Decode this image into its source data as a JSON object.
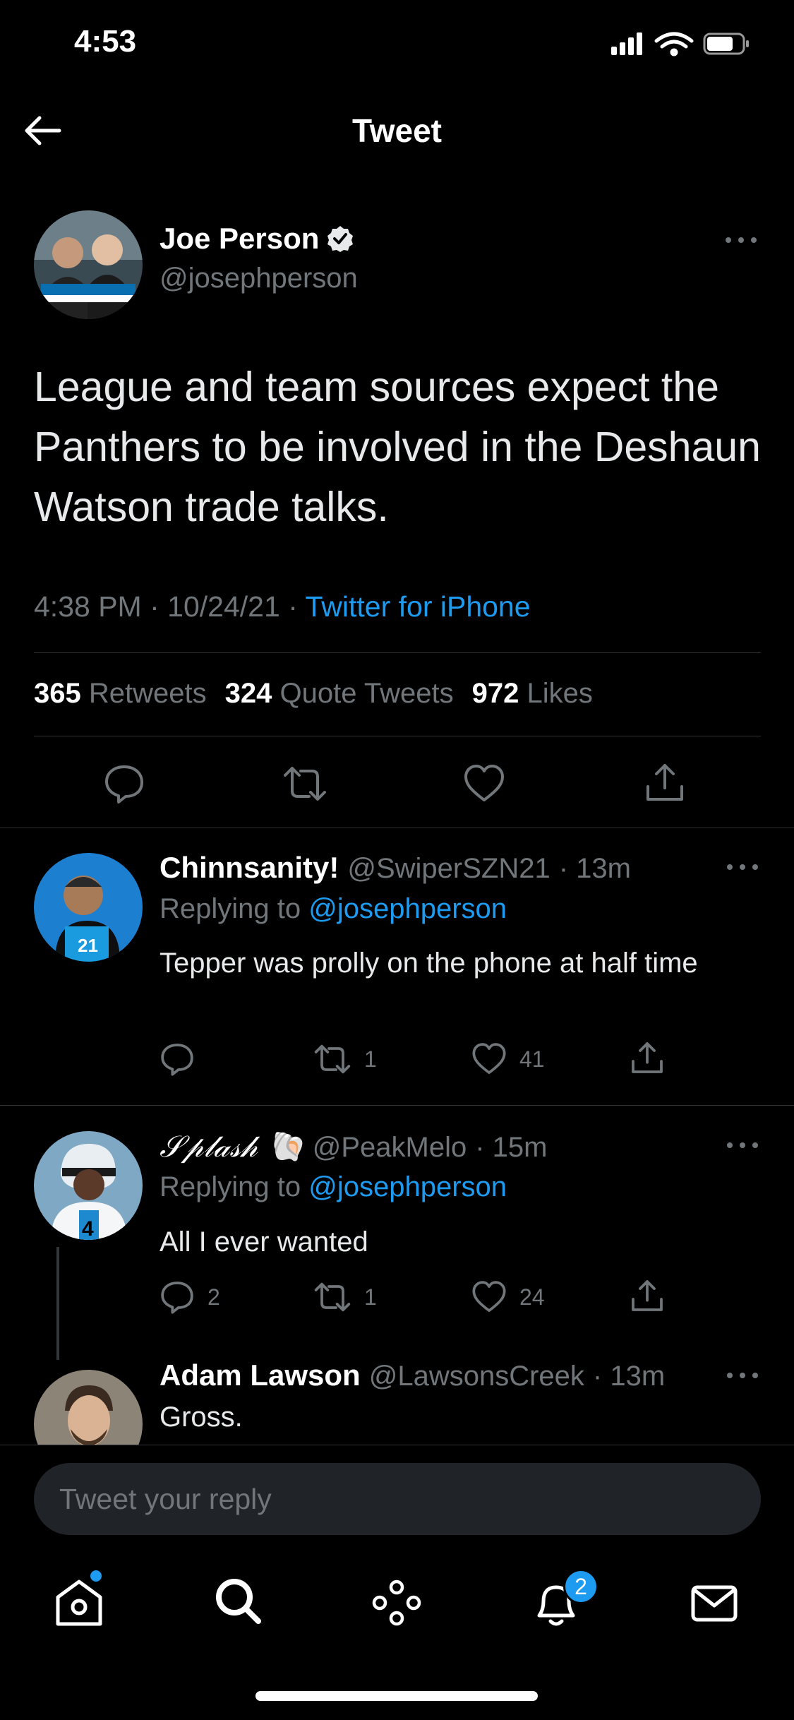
{
  "status_bar": {
    "time": "4:53"
  },
  "header": {
    "title": "Tweet",
    "back_icon": "back-arrow-icon"
  },
  "tweet": {
    "author_name": "Joe Person",
    "author_handle": "@josephperson",
    "verified": true,
    "text": "League and team sources expect the Panthers to be involved in the Deshaun Watson trade talks.",
    "time": "4:38 PM",
    "date": "10/24/21",
    "source": "Twitter for iPhone",
    "separator": "·",
    "stats": {
      "retweets_count": "365",
      "retweets_label": "Retweets",
      "quotes_count": "324",
      "quotes_label": "Quote Tweets",
      "likes_count": "972",
      "likes_label": "Likes"
    }
  },
  "replies": [
    {
      "name": "Chinnsanity!",
      "handle": "@SwiperSZN21",
      "time": "· 13m",
      "replying_prefix": "Replying to",
      "replying_to": "@josephperson",
      "text": "Tepper was prolly on the phone at half time",
      "reply_count": "",
      "retweet_count": "1",
      "like_count": "41"
    },
    {
      "name": "𝒮𝓅𝓁𝒶𝓈𝒽 🐚",
      "handle": "@PeakMelo",
      "time": "· 15m",
      "replying_prefix": "Replying to",
      "replying_to": "@josephperson",
      "text": "All I ever wanted",
      "reply_count": "2",
      "retweet_count": "1",
      "like_count": "24"
    },
    {
      "name": "Adam Lawson",
      "handle": "@LawsonsCreek",
      "time": "· 13m",
      "text": "Gross."
    }
  ],
  "compose": {
    "placeholder": "Tweet your reply"
  },
  "nav": {
    "items": [
      "home-icon",
      "search-icon",
      "spaces-icon",
      "notifications-icon",
      "messages-icon"
    ],
    "notification_badge": "2"
  },
  "colors": {
    "background": "#000000",
    "accent": "#1d9bf0",
    "secondary_text": "#71767b",
    "divider": "#2f3336"
  }
}
